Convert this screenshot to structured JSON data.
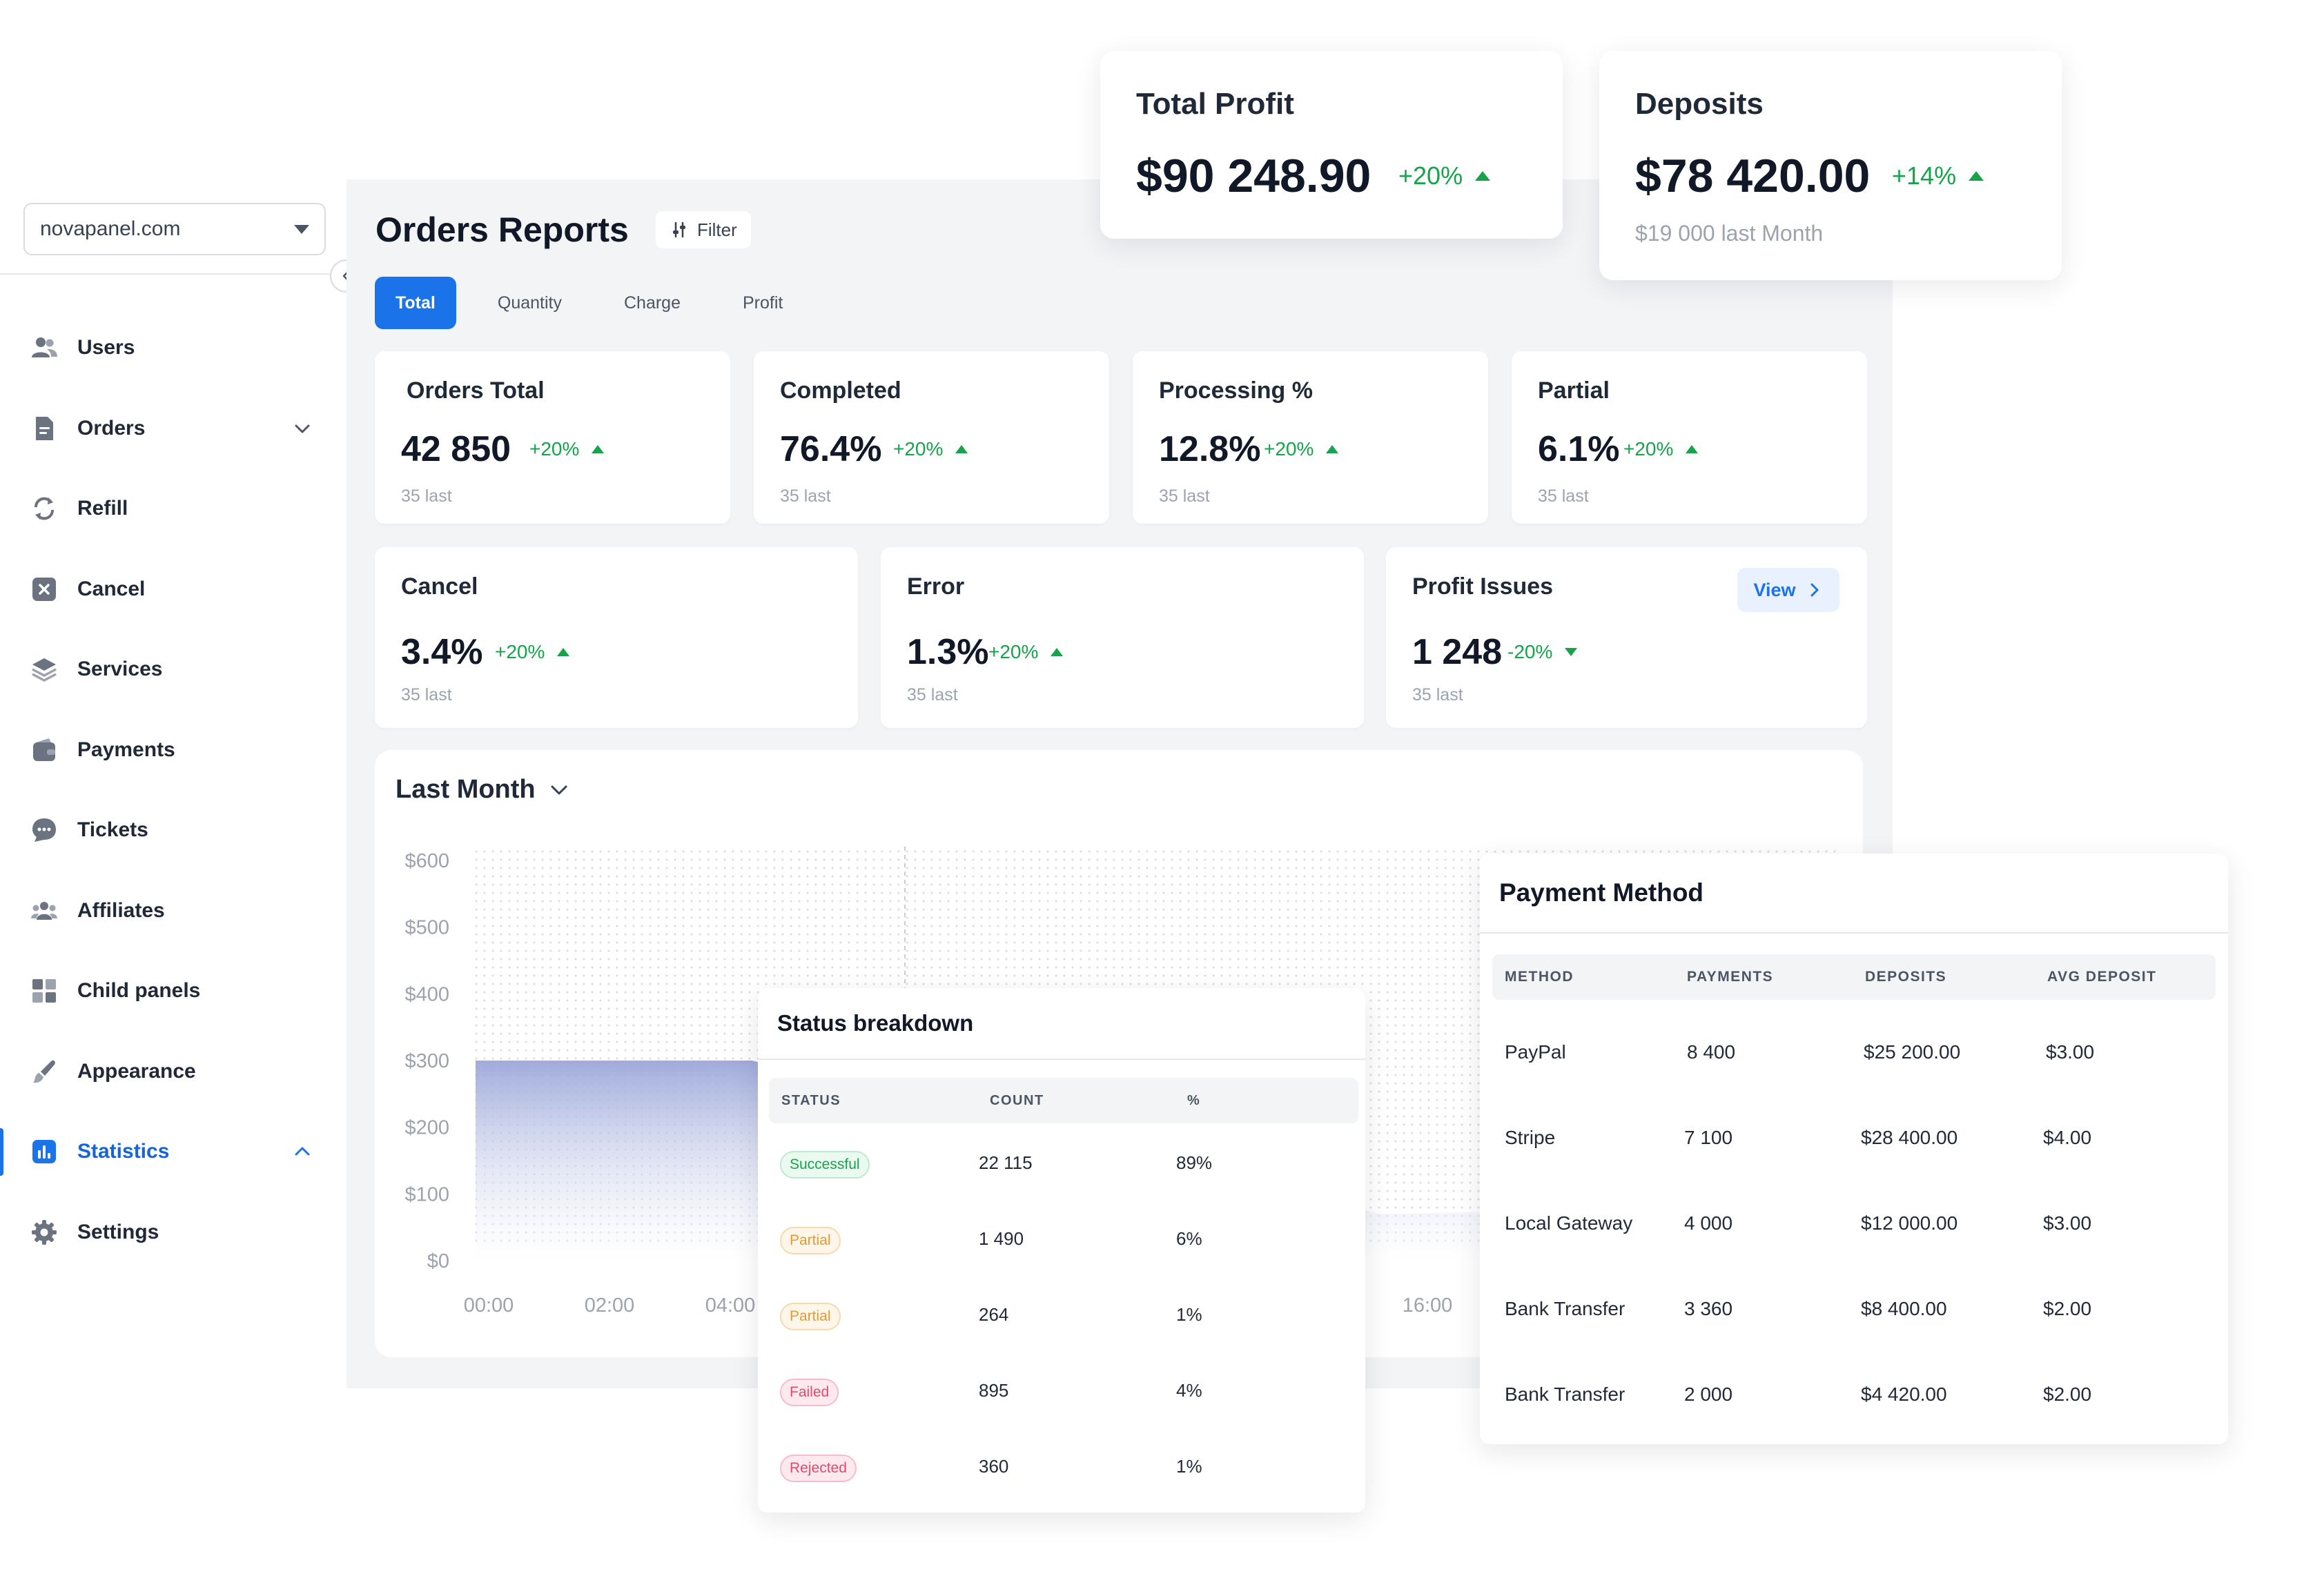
{
  "sidebar": {
    "domain": "novapanel.com",
    "items": [
      {
        "label": "Users",
        "icon": "users-icon"
      },
      {
        "label": "Orders",
        "icon": "document-icon",
        "expand": "down"
      },
      {
        "label": "Refill",
        "icon": "refresh-icon"
      },
      {
        "label": "Cancel",
        "icon": "cancel-icon"
      },
      {
        "label": "Services",
        "icon": "layers-icon"
      },
      {
        "label": "Payments",
        "icon": "wallet-icon"
      },
      {
        "label": "Tickets",
        "icon": "chat-icon"
      },
      {
        "label": "Affiliates",
        "icon": "group-icon"
      },
      {
        "label": "Child panels",
        "icon": "grid-icon"
      },
      {
        "label": "Appearance",
        "icon": "brush-icon"
      },
      {
        "label": "Statistics",
        "icon": "bar-chart-icon",
        "expand": "up",
        "active": true
      },
      {
        "label": "Settings",
        "icon": "gear-icon"
      }
    ]
  },
  "header": {
    "title": "Orders Reports",
    "filter_label": "Filter",
    "tabs": [
      "Total",
      "Quantity",
      "Charge",
      "Profit"
    ],
    "active_tab": "Total"
  },
  "summary": {
    "total_profit": {
      "title": "Total Profit",
      "value": "$90 248.90",
      "delta": "+20%"
    },
    "deposits": {
      "title": "Deposits",
      "value": "$78 420.00",
      "delta": "+14%",
      "sub": "$19 000 last Month"
    }
  },
  "stats_row1": [
    {
      "title": "Orders Total",
      "value": "42 850",
      "delta": "+20%",
      "sub": "35 last"
    },
    {
      "title": "Completed",
      "value": "76.4%",
      "delta": "+20%",
      "sub": "35 last"
    },
    {
      "title": "Processing %",
      "value": "12.8%",
      "delta": "+20%",
      "sub": "35 last"
    },
    {
      "title": "Partial",
      "value": "6.1%",
      "delta": "+20%",
      "sub": "35 last"
    }
  ],
  "stats_row2": [
    {
      "title": "Cancel",
      "value": "3.4%",
      "delta": "+20%",
      "sub": "35 last"
    },
    {
      "title": "Error",
      "value": "1.3%",
      "delta": "+20%",
      "sub": "35 last"
    },
    {
      "title": "Profit Issues",
      "value": "1 248",
      "delta": "-20%",
      "sub": "35 last",
      "action": "View"
    }
  ],
  "chart": {
    "period_label": "Last Month",
    "colors": {
      "fill_top": "#9aa6d9",
      "fill_bottom": "#ffffff",
      "grid_dot": "#d8dbe2",
      "axis_text": "#9ca3af"
    }
  },
  "chart_data": {
    "type": "area",
    "y_ticks": [
      "$600",
      "$500",
      "$400",
      "$300",
      "$200",
      "$100",
      "$0"
    ],
    "x_ticks": [
      "00:00",
      "02:00",
      "04:00",
      "16:00"
    ],
    "ylim": [
      0,
      600
    ],
    "x": [
      0,
      2.9,
      9.5,
      15,
      16.5
    ],
    "values": [
      300,
      300,
      70,
      85,
      55
    ]
  },
  "status_breakdown": {
    "title": "Status breakdown",
    "columns": [
      "STATUS",
      "COUNT",
      "%"
    ],
    "rows": [
      {
        "status": "Successful",
        "kind": "success",
        "count": "22 115",
        "pct": "89%"
      },
      {
        "status": "Partial",
        "kind": "partial",
        "count": "1 490",
        "pct": "6%"
      },
      {
        "status": "Partial",
        "kind": "partial",
        "count": "264",
        "pct": "1%"
      },
      {
        "status": "Failed",
        "kind": "failed",
        "count": "895",
        "pct": "4%"
      },
      {
        "status": "Rejected",
        "kind": "failed",
        "count": "360",
        "pct": "1%"
      }
    ]
  },
  "payment_method": {
    "title": "Payment Method",
    "columns": [
      "METHOD",
      "PAYMENTS",
      "DEPOSITS",
      "AVG DEPOSIT"
    ],
    "rows": [
      {
        "method": "PayPal",
        "payments": "8 400",
        "deposits": "$25 200.00",
        "avg": "$3.00"
      },
      {
        "method": "Stripe",
        "payments": "7 100",
        "deposits": "$28 400.00",
        "avg": "$4.00"
      },
      {
        "method": "Local Gateway",
        "payments": "4 000",
        "deposits": "$12 000.00",
        "avg": "$3.00"
      },
      {
        "method": "Bank Transfer",
        "payments": "3 360",
        "deposits": "$8 400.00",
        "avg": "$2.00"
      },
      {
        "method": "Bank Transfer",
        "payments": "2 000",
        "deposits": "$4 420.00",
        "avg": "$2.00"
      }
    ]
  }
}
